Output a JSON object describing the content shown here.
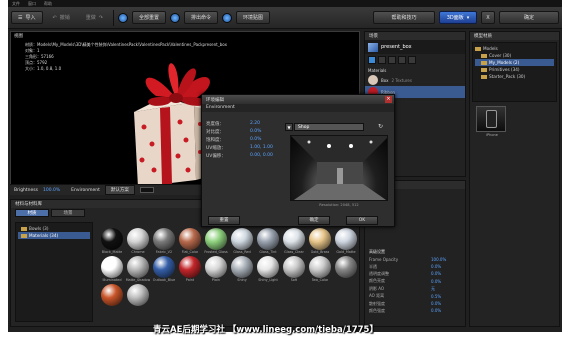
{
  "titlebar": {
    "items": [
      "文件",
      "窗口",
      "帮助"
    ],
    "right": [
      "Sketch Rendering Pack",
      "Element"
    ]
  },
  "toolbar": {
    "import": "导入",
    "undo": "撤销",
    "redo": "重做",
    "reset_scene": "全部重置",
    "render_cmd": "排出命令",
    "env_map": "环境贴图",
    "help": "帮助和技巧",
    "mode": "3D面板",
    "close": "X",
    "ok": "确定"
  },
  "viewport": {
    "title": "视图",
    "info": [
      "材质：Models\\My_Models\\3D\\精美个性装饰\\ValentinesPack\\ValentinesPack\\Valentines_Packpresent_box",
      "对象：1",
      "三角形：57166",
      "顶点：5792",
      "大小：1.0, 0.8, 1.0"
    ]
  },
  "vbar": {
    "brightness_label": "Brightness",
    "brightness_value": "100.0%",
    "env_label": "Environment",
    "env_value": "默认方案",
    "bg_label": "背景设置"
  },
  "library": {
    "title": "材料与材料库",
    "tabs": [
      "材质",
      "场景"
    ],
    "tree": [
      "Bowls (3)",
      "Materials (34)"
    ],
    "materials": [
      {
        "name": "Black_Matte",
        "color": "#111111"
      },
      {
        "name": "Chrome",
        "color": "#d5d5d5"
      },
      {
        "name": "Fabric_V2",
        "color": "#7a7a7a"
      },
      {
        "name": "Flat_Color",
        "color": "#b86a4c"
      },
      {
        "name": "Frosted_Glass",
        "color": "#8fd27f"
      },
      {
        "name": "Glass_Red",
        "color": "#cfd8e0"
      },
      {
        "name": "Glass_Tint",
        "color": "#9aa3b0"
      },
      {
        "name": "Glass_Clear",
        "color": "#dde3e8"
      },
      {
        "name": "Gold_Brass",
        "color": "#e8c68a"
      },
      {
        "name": "Gold_Matte",
        "color": "#cfd6e0"
      },
      {
        "name": "Illuminated",
        "color": "#ffffff"
      },
      {
        "name": "Matte_Shadow",
        "color": "#b9b9b9"
      },
      {
        "name": "Outlook_Blue",
        "color": "#355fa8"
      },
      {
        "name": "Paint",
        "color": "#c2262a"
      },
      {
        "name": "Plain",
        "color": "#d7d7d7"
      },
      {
        "name": "Shiny",
        "color": "#a9b0b8"
      },
      {
        "name": "Shiny_Light",
        "color": "#e7e7e7"
      },
      {
        "name": "Soft",
        "color": "#c8c8c8"
      },
      {
        "name": "Two_Color",
        "color": "#cccccc"
      },
      {
        "name": "",
        "color": "#888888"
      },
      {
        "name": "",
        "color": "#c9552a"
      },
      {
        "name": "",
        "color": "#bfbfbf"
      }
    ]
  },
  "scene": {
    "title": "场景",
    "object": "present_box",
    "section": "Materials",
    "mats": [
      {
        "name": "Box",
        "sub": "2 Textures",
        "color": "#d9c8b8"
      },
      {
        "name": "Ribbon",
        "sub": "",
        "color": "#c21c24"
      }
    ]
  },
  "props": {
    "title": "材质",
    "section": "高级设置",
    "rows": [
      {
        "k": "",
        "v": ""
      },
      {
        "k": "",
        "v": ""
      },
      {
        "k": "",
        "v": ""
      },
      {
        "k": "",
        "v": ""
      },
      {
        "k": "",
        "v": ""
      },
      {
        "k": "",
        "v": ""
      },
      {
        "k": "",
        "v": ""
      },
      {
        "k": "",
        "v": ""
      },
      {
        "k": "Frame Opacity",
        "v": "100.0%"
      },
      {
        "k": "半透",
        "v": "0.0%"
      },
      {
        "k": "透明度调整",
        "v": "0.0%"
      },
      {
        "k": "颜色亮度",
        "v": "0.0%"
      },
      {
        "k": "阴影 AO",
        "v": "无"
      },
      {
        "k": "AO 距离",
        "v": "0.5%"
      },
      {
        "k": "散射强度",
        "v": "0.0%"
      },
      {
        "k": "颜色强度",
        "v": "0.0%"
      }
    ]
  },
  "right": {
    "title": "模型材质",
    "tree": [
      "Models",
      "Cover (30)",
      "My_Models (2)",
      "Primitives (34)",
      "Starter_Pack (30)"
    ],
    "preview_label": "iPhone"
  },
  "dialog": {
    "title": "环境编辑",
    "section": "Environment",
    "rows": [
      {
        "k": "亮度值：",
        "v": "2.20"
      },
      {
        "k": "对比度：",
        "v": "0.0%"
      },
      {
        "k": "饱和度：",
        "v": "0.0%"
      },
      {
        "k": "UV缩放：",
        "v": "1.00, 1.00"
      },
      {
        "k": "UV偏移：",
        "v": "0.00, 0.00"
      }
    ],
    "env_name": "Shop",
    "resolution": "Resolution: 2048, 512",
    "buttons": [
      "重置",
      "确定",
      "OK"
    ]
  },
  "watermark": "青云AE后期学习社 【www.lineeg.com/tieba/1775】"
}
